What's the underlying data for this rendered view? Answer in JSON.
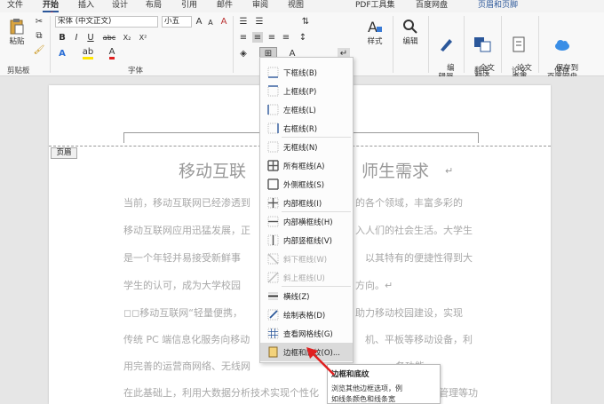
{
  "tabs": [
    "文件",
    "开始",
    "插入",
    "设计",
    "布局",
    "引用",
    "邮件",
    "审阅",
    "视图",
    "PDF工具集",
    "百度网盘",
    "页眉和页脚"
  ],
  "clipboard": {
    "paste_label": "粘贴",
    "group_label": "剪贴板"
  },
  "font": {
    "name": "宋体 (中文正文)",
    "size": "小五",
    "group_label": "字体",
    "bold": "B",
    "italic": "I",
    "underline": "U",
    "strike": "abc",
    "sub": "X₂",
    "sup": "X²",
    "clear": "A",
    "grow": "A",
    "shrink": "A",
    "font_color": "A",
    "highlight": "ab"
  },
  "paragraph": {
    "group_label": "段"
  },
  "styles": {
    "label": "样式"
  },
  "editing": {
    "label": "编辑"
  },
  "editor": {
    "label": "编\n辑器"
  },
  "translate": {
    "label": "全文\n翻译",
    "group_label": "翻译"
  },
  "paper_check": {
    "label": "论文\n查重",
    "group_label": "论文"
  },
  "save_baidu": {
    "label": "保存到\n百度网盘",
    "group_label": "保存"
  },
  "header_tag": "页眉",
  "document": {
    "title_left": "移动互联",
    "title_right": "师生需求",
    "return_mark": "↵",
    "lines": [
      {
        "left": "当前，移动互联网已经渗透到",
        "right": "的各个领域，丰富多彩的"
      },
      {
        "left": "移动互联网应用迅猛发展，正",
        "right": "入人们的社会生活。大学生"
      },
      {
        "left": "是一个年轻并易接受新鲜事",
        "right": "以其特有的便捷性得到大"
      },
      {
        "left": "学生的认可，成为大学校园",
        "right": "方向。↵"
      },
      {
        "left": "◻◻移动互联网“轻量便携，",
        "right": "助力移动校园建设，实现"
      },
      {
        "left": "传统 PC 端信息化服务向移动",
        "right": "机、平板等移动设备，利"
      },
      {
        "left": "用完善的运营商网络、无线网",
        "right": "务功能;"
      },
      {
        "left": "在此基础上，利用大数据分析技术实现个性化",
        "right": "户管理等功"
      }
    ]
  },
  "border_menu": {
    "items": [
      {
        "label": "下框线(B)",
        "icon": "bottom-border-icon"
      },
      {
        "label": "上框线(P)",
        "icon": "top-border-icon"
      },
      {
        "label": "左框线(L)",
        "icon": "left-border-icon"
      },
      {
        "label": "右框线(R)",
        "icon": "right-border-icon"
      },
      {
        "label": "无框线(N)",
        "icon": "no-border-icon"
      },
      {
        "label": "所有框线(A)",
        "icon": "all-borders-icon"
      },
      {
        "label": "外侧框线(S)",
        "icon": "outside-borders-icon"
      },
      {
        "label": "内部框线(I)",
        "icon": "inside-borders-icon"
      },
      {
        "label": "内部横框线(H)",
        "icon": "inside-horizontal-border-icon"
      },
      {
        "label": "内部竖框线(V)",
        "icon": "inside-vertical-border-icon"
      },
      {
        "label": "斜下框线(W)",
        "icon": "diagonal-down-border-icon"
      },
      {
        "label": "斜上框线(U)",
        "icon": "diagonal-up-border-icon"
      },
      {
        "label": "横线(Z)",
        "icon": "horizontal-line-icon"
      },
      {
        "label": "绘制表格(D)",
        "icon": "draw-table-icon"
      },
      {
        "label": "查看网格线(G)",
        "icon": "view-gridlines-icon"
      },
      {
        "label": "边框和底纹(O)...",
        "icon": "borders-shading-icon"
      }
    ]
  },
  "tooltip": {
    "title": "边框和底纹",
    "line1": "浏览其他边框选项，例",
    "line2": "如线条颜色和线条宽"
  },
  "colors": {
    "accent": "#2b579a",
    "arrow": "#e02020"
  }
}
